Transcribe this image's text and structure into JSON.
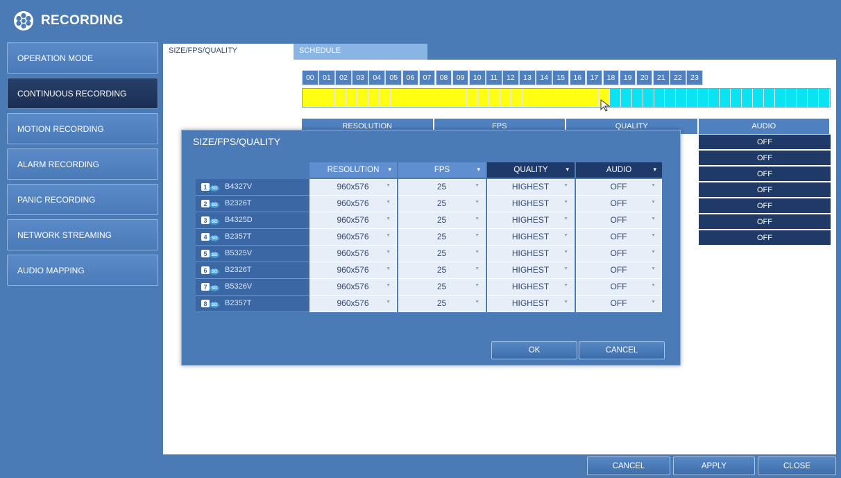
{
  "window": {
    "title": "RECORDING"
  },
  "sidebar": {
    "items": [
      {
        "label": "OPERATION MODE"
      },
      {
        "label": "CONTINUOUS RECORDING"
      },
      {
        "label": "MOTION RECORDING"
      },
      {
        "label": "ALARM RECORDING"
      },
      {
        "label": "PANIC RECORDING"
      },
      {
        "label": "NETWORK STREAMING"
      },
      {
        "label": "AUDIO MAPPING"
      }
    ],
    "active_index": 1
  },
  "tabs": [
    {
      "label": "SIZE/FPS/QUALITY"
    },
    {
      "label": "SCHEDULE"
    }
  ],
  "hours": [
    "00",
    "01",
    "02",
    "03",
    "04",
    "05",
    "06",
    "07",
    "08",
    "09",
    "10",
    "11",
    "12",
    "13",
    "14",
    "15",
    "16",
    "17",
    "18",
    "19",
    "20",
    "21",
    "22",
    "23"
  ],
  "timeline": {
    "yellow_until_hour": 14,
    "colors": {
      "yellow": "#ffff12",
      "cyan": "#0ae4f2"
    }
  },
  "background_table": {
    "headers": [
      "RESOLUTION",
      "FPS",
      "QUALITY",
      "AUDIO"
    ],
    "audio_values": [
      "OFF",
      "OFF",
      "OFF",
      "OFF",
      "OFF",
      "OFF",
      "OFF"
    ]
  },
  "dialog": {
    "title": "SIZE/FPS/QUALITY",
    "headers": {
      "resolution": "RESOLUTION",
      "fps": "FPS",
      "quality": "QUALITY",
      "audio": "AUDIO"
    },
    "rows": [
      {
        "num": "1",
        "sd": "SD",
        "name": "B4327V",
        "resolution": "960x576",
        "fps": "25",
        "quality": "HIGHEST",
        "audio": "OFF"
      },
      {
        "num": "2",
        "sd": "SD",
        "name": "B2326T",
        "resolution": "960x576",
        "fps": "25",
        "quality": "HIGHEST",
        "audio": "OFF"
      },
      {
        "num": "3",
        "sd": "SD",
        "name": "B4325D",
        "resolution": "960x576",
        "fps": "25",
        "quality": "HIGHEST",
        "audio": "OFF"
      },
      {
        "num": "4",
        "sd": "SD",
        "name": "B2357T",
        "resolution": "960x576",
        "fps": "25",
        "quality": "HIGHEST",
        "audio": "OFF"
      },
      {
        "num": "5",
        "sd": "SD",
        "name": "B5325V",
        "resolution": "960x576",
        "fps": "25",
        "quality": "HIGHEST",
        "audio": "OFF"
      },
      {
        "num": "6",
        "sd": "SD",
        "name": "B2326T",
        "resolution": "960x576",
        "fps": "25",
        "quality": "HIGHEST",
        "audio": "OFF"
      },
      {
        "num": "7",
        "sd": "SD",
        "name": "B5326V",
        "resolution": "960x576",
        "fps": "25",
        "quality": "HIGHEST",
        "audio": "OFF"
      },
      {
        "num": "8",
        "sd": "SD",
        "name": "B2357T",
        "resolution": "960x576",
        "fps": "25",
        "quality": "HIGHEST",
        "audio": "OFF"
      }
    ],
    "ok_label": "OK",
    "cancel_label": "CANCEL"
  },
  "footer": {
    "cancel_label": "CANCEL",
    "apply_label": "APPLY",
    "close_label": "CLOSE"
  },
  "icons": {
    "title": "film-reel-icon",
    "cursor": "mouse-pointer-icon",
    "dropdown": "dropdown-arrow-icon"
  }
}
